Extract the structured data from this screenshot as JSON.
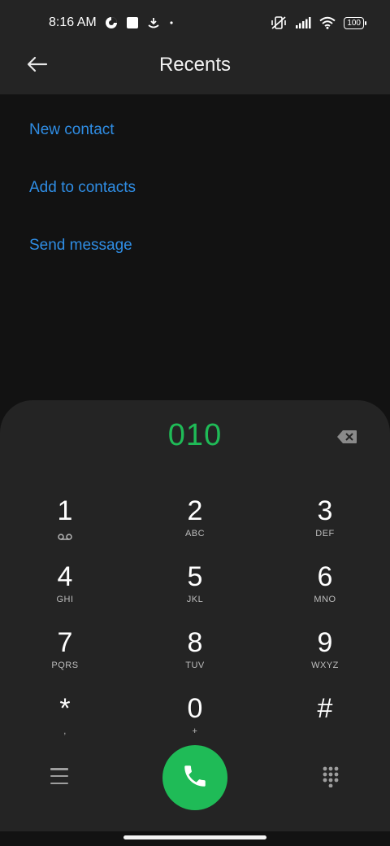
{
  "status_bar": {
    "time": "8:16 AM",
    "battery": "100",
    "icons": [
      "data-saver-icon",
      "square-notification-icon",
      "download-icon",
      "dot-icon",
      "muted-vibrate-icon",
      "signal-icon",
      "wifi-icon"
    ]
  },
  "header": {
    "title": "Recents",
    "back_icon": "back-arrow-icon"
  },
  "options": {
    "new_contact": "New contact",
    "add_to_contacts": "Add to contacts",
    "send_message": "Send message"
  },
  "dialer": {
    "number": "010",
    "keys": [
      {
        "digit": "1",
        "sub": ""
      },
      {
        "digit": "2",
        "sub": "ABC"
      },
      {
        "digit": "3",
        "sub": "DEF"
      },
      {
        "digit": "4",
        "sub": "GHI"
      },
      {
        "digit": "5",
        "sub": "JKL"
      },
      {
        "digit": "6",
        "sub": "MNO"
      },
      {
        "digit": "7",
        "sub": "PQRS"
      },
      {
        "digit": "8",
        "sub": "TUV"
      },
      {
        "digit": "9",
        "sub": "WXYZ"
      },
      {
        "digit": "*",
        "sub": ","
      },
      {
        "digit": "0",
        "sub": "+"
      },
      {
        "digit": "#",
        "sub": ""
      }
    ]
  },
  "colors": {
    "accent_blue": "#2f8de4",
    "call_green": "#1fbb57",
    "panel": "#242424",
    "background": "#121212"
  }
}
